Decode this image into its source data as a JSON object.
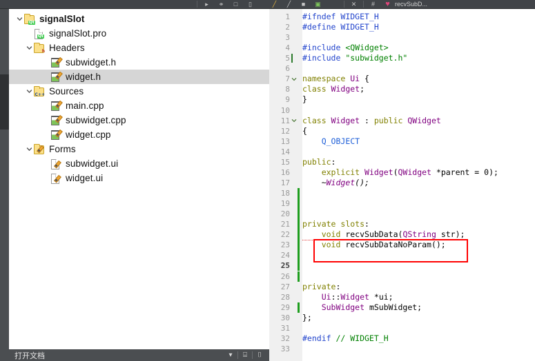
{
  "window": {
    "bg_color": "#3c3f41",
    "accent_highlight": "#ff0000"
  },
  "toolbar": {
    "icons": [
      {
        "name": "run-icon",
        "glyph": "▶"
      },
      {
        "name": "debug-icon",
        "glyph": "▷"
      },
      {
        "name": "build-icon",
        "glyph": "⬛"
      },
      {
        "name": "project-icon",
        "glyph": "⬜"
      },
      {
        "name": "pencil-icon",
        "glyph": "╱"
      },
      {
        "name": "slash-icon",
        "glyph": "╱"
      },
      {
        "name": "stop-icon",
        "glyph": "■"
      },
      {
        "name": "image-icon",
        "glyph": "▣"
      },
      {
        "name": "close-icon",
        "glyph": "✕"
      },
      {
        "name": "hash-icon",
        "glyph": "#"
      },
      {
        "name": "heart-icon",
        "glyph": "♥"
      }
    ],
    "trailing_label": "recvSubD..."
  },
  "project_tree": {
    "nodes": [
      {
        "indent": 0,
        "twisty": "expanded",
        "icon": "qt-project-folder-icon",
        "label": "signalSlot",
        "bold": true,
        "selected": false
      },
      {
        "indent": 1,
        "twisty": "none",
        "icon": "qt-pro-file-icon",
        "label": "signalSlot.pro",
        "bold": false,
        "selected": false
      },
      {
        "indent": 1,
        "twisty": "expanded",
        "icon": "headers-folder-icon",
        "label": "Headers",
        "bold": false,
        "selected": false
      },
      {
        "indent": 2,
        "twisty": "none",
        "icon": "header-file-icon",
        "label": "subwidget.h",
        "bold": false,
        "selected": false
      },
      {
        "indent": 2,
        "twisty": "none",
        "icon": "header-file-icon",
        "label": "widget.h",
        "bold": false,
        "selected": true
      },
      {
        "indent": 1,
        "twisty": "expanded",
        "icon": "sources-folder-icon",
        "label": "Sources",
        "bold": false,
        "selected": false
      },
      {
        "indent": 2,
        "twisty": "none",
        "icon": "source-file-icon",
        "label": "main.cpp",
        "bold": false,
        "selected": false
      },
      {
        "indent": 2,
        "twisty": "none",
        "icon": "source-file-icon",
        "label": "subwidget.cpp",
        "bold": false,
        "selected": false
      },
      {
        "indent": 2,
        "twisty": "none",
        "icon": "source-file-icon",
        "label": "widget.cpp",
        "bold": false,
        "selected": false
      },
      {
        "indent": 1,
        "twisty": "expanded",
        "icon": "forms-folder-icon",
        "label": "Forms",
        "bold": false,
        "selected": false
      },
      {
        "indent": 2,
        "twisty": "none",
        "icon": "ui-file-icon",
        "label": "subwidget.ui",
        "bold": false,
        "selected": false
      },
      {
        "indent": 2,
        "twisty": "none",
        "icon": "ui-file-icon",
        "label": "widget.ui",
        "bold": false,
        "selected": false
      }
    ]
  },
  "tree_bottom_bar": {
    "label": "打开文档",
    "dropdown_glyph": "▾",
    "split_glyph": "⌸",
    "close_glyph": "⌷"
  },
  "editor": {
    "filename": "widget.h",
    "current_line": 25,
    "total_lines": 33,
    "lines": [
      {
        "n": 1,
        "fold": "",
        "changed": false,
        "text": "#ifndef WIDGET_H",
        "tokens": [
          {
            "t": "#ifndef ",
            "c": "t-pp"
          },
          {
            "t": "WIDGET_H",
            "c": "t-pp"
          }
        ]
      },
      {
        "n": 2,
        "fold": "",
        "changed": false,
        "text": "#define WIDGET_H",
        "tokens": [
          {
            "t": "#define ",
            "c": "t-pp"
          },
          {
            "t": "WIDGET_H",
            "c": "t-pp"
          }
        ]
      },
      {
        "n": 3,
        "fold": "",
        "changed": false,
        "text": "",
        "tokens": []
      },
      {
        "n": 4,
        "fold": "",
        "changed": false,
        "text": "#include <QWidget>",
        "tokens": [
          {
            "t": "#include ",
            "c": "t-pp"
          },
          {
            "t": "<QWidget>",
            "c": "t-str"
          }
        ]
      },
      {
        "n": 5,
        "fold": "",
        "changed": false,
        "text": "#include \"subwidget.h\"",
        "tokens": [
          {
            "t": "#include ",
            "c": "t-pp"
          },
          {
            "t": "\"subwidget.h\"",
            "c": "t-str"
          }
        ]
      },
      {
        "n": 6,
        "fold": "",
        "changed": false,
        "text": "",
        "tokens": []
      },
      {
        "n": 7,
        "fold": "v",
        "changed": false,
        "text": "namespace Ui {",
        "tokens": [
          {
            "t": "namespace ",
            "c": "t-kw"
          },
          {
            "t": "Ui",
            "c": "t-type"
          },
          {
            "t": " {",
            "c": "t-fn"
          }
        ]
      },
      {
        "n": 8,
        "fold": "",
        "changed": false,
        "text": "class Widget;",
        "tokens": [
          {
            "t": "class ",
            "c": "t-kw"
          },
          {
            "t": "Widget",
            "c": "t-type"
          },
          {
            "t": ";",
            "c": "t-fn"
          }
        ]
      },
      {
        "n": 9,
        "fold": "",
        "changed": false,
        "text": "}",
        "tokens": [
          {
            "t": "}",
            "c": "t-fn"
          }
        ]
      },
      {
        "n": 10,
        "fold": "",
        "changed": false,
        "text": "",
        "tokens": []
      },
      {
        "n": 11,
        "fold": "v",
        "changed": false,
        "text": "class Widget : public QWidget",
        "tokens": [
          {
            "t": "class ",
            "c": "t-kw"
          },
          {
            "t": "Widget",
            "c": "t-type"
          },
          {
            "t": " : ",
            "c": "t-fn"
          },
          {
            "t": "public ",
            "c": "t-kw"
          },
          {
            "t": "QWidget",
            "c": "t-type"
          }
        ]
      },
      {
        "n": 12,
        "fold": "",
        "changed": false,
        "text": "{",
        "tokens": [
          {
            "t": "{",
            "c": "t-fn"
          }
        ]
      },
      {
        "n": 13,
        "fold": "",
        "changed": false,
        "text": "    Q_OBJECT",
        "tokens": [
          {
            "t": "    ",
            "c": "t-fn"
          },
          {
            "t": "Q_OBJECT",
            "c": "t-mac"
          }
        ]
      },
      {
        "n": 14,
        "fold": "",
        "changed": false,
        "text": "",
        "tokens": []
      },
      {
        "n": 15,
        "fold": "",
        "changed": false,
        "text": "public:",
        "tokens": [
          {
            "t": "public",
            "c": "t-kw"
          },
          {
            "t": ":",
            "c": "t-fn"
          }
        ]
      },
      {
        "n": 16,
        "fold": "",
        "changed": false,
        "text": "    explicit Widget(QWidget *parent = 0);",
        "tokens": [
          {
            "t": "    ",
            "c": "t-fn"
          },
          {
            "t": "explicit ",
            "c": "t-kw"
          },
          {
            "t": "Widget",
            "c": "t-type"
          },
          {
            "t": "(",
            "c": "t-fn"
          },
          {
            "t": "QWidget",
            "c": "t-type"
          },
          {
            "t": " *parent = ",
            "c": "t-fn"
          },
          {
            "t": "0",
            "c": "t-num"
          },
          {
            "t": ");",
            "c": "t-fn"
          }
        ]
      },
      {
        "n": 17,
        "fold": "",
        "changed": false,
        "text": "    ~Widget();",
        "tokens": [
          {
            "t": "    ~",
            "c": "t-ital"
          },
          {
            "t": "Widget",
            "c": "t-typeital"
          },
          {
            "t": "();",
            "c": "t-ital"
          }
        ]
      },
      {
        "n": 18,
        "fold": "",
        "changed": true,
        "text": "",
        "tokens": []
      },
      {
        "n": 19,
        "fold": "",
        "changed": true,
        "text": "",
        "tokens": []
      },
      {
        "n": 20,
        "fold": "",
        "changed": true,
        "text": "",
        "tokens": []
      },
      {
        "n": 21,
        "fold": "",
        "changed": true,
        "text": "private slots:",
        "tokens": [
          {
            "t": "private ",
            "c": "t-kw"
          },
          {
            "t": "slots",
            "c": "t-kw"
          },
          {
            "t": ":",
            "c": "t-fn"
          }
        ]
      },
      {
        "n": 22,
        "fold": "",
        "changed": true,
        "text": "    void recvSubData(QString str);",
        "tokens": [
          {
            "t": "    ",
            "c": "t-fn"
          },
          {
            "t": "void ",
            "c": "t-kw"
          },
          {
            "t": "recvSubData",
            "c": "t-fn"
          },
          {
            "t": "(",
            "c": "t-fn"
          },
          {
            "t": "QString",
            "c": "t-type"
          },
          {
            "t": " str);",
            "c": "t-fn"
          }
        ]
      },
      {
        "n": 23,
        "fold": "",
        "changed": true,
        "text": "    void recvSubDataNoParam();",
        "tokens": [
          {
            "t": "    ",
            "c": "t-fn"
          },
          {
            "t": "void ",
            "c": "t-kw"
          },
          {
            "t": "recvSubDataNoParam",
            "c": "t-fn"
          },
          {
            "t": "();",
            "c": "t-fn"
          }
        ]
      },
      {
        "n": 24,
        "fold": "",
        "changed": true,
        "text": "",
        "tokens": []
      },
      {
        "n": 25,
        "fold": "",
        "changed": true,
        "text": "",
        "tokens": [],
        "current": true
      },
      {
        "n": 26,
        "fold": "",
        "changed": true,
        "text": "",
        "tokens": []
      },
      {
        "n": 27,
        "fold": "",
        "changed": false,
        "text": "private:",
        "tokens": [
          {
            "t": "private",
            "c": "t-kw"
          },
          {
            "t": ":",
            "c": "t-fn"
          }
        ]
      },
      {
        "n": 28,
        "fold": "",
        "changed": false,
        "text": "    Ui::Widget *ui;",
        "tokens": [
          {
            "t": "    ",
            "c": "t-fn"
          },
          {
            "t": "Ui",
            "c": "t-type"
          },
          {
            "t": "::",
            "c": "t-fn"
          },
          {
            "t": "Widget",
            "c": "t-type"
          },
          {
            "t": " *ui;",
            "c": "t-fn"
          }
        ]
      },
      {
        "n": 29,
        "fold": "",
        "changed": true,
        "text": "    SubWidget mSubWidget;",
        "tokens": [
          {
            "t": "    ",
            "c": "t-fn"
          },
          {
            "t": "SubWidget",
            "c": "t-type"
          },
          {
            "t": " mSubWidget;",
            "c": "t-fn"
          }
        ]
      },
      {
        "n": 30,
        "fold": "",
        "changed": false,
        "text": "};",
        "tokens": [
          {
            "t": "};",
            "c": "t-fn"
          }
        ]
      },
      {
        "n": 31,
        "fold": "",
        "changed": false,
        "text": "",
        "tokens": []
      },
      {
        "n": 32,
        "fold": "",
        "changed": false,
        "text": "#endif // WIDGET_H",
        "tokens": [
          {
            "t": "#endif ",
            "c": "t-pp"
          },
          {
            "t": "// WIDGET_H",
            "c": "t-cmt"
          }
        ]
      },
      {
        "n": 33,
        "fold": "",
        "changed": false,
        "text": "",
        "tokens": []
      }
    ],
    "annotation": {
      "name": "red-highlight-box",
      "color": "#ff0000",
      "covers_lines": [
        23,
        24
      ]
    }
  }
}
